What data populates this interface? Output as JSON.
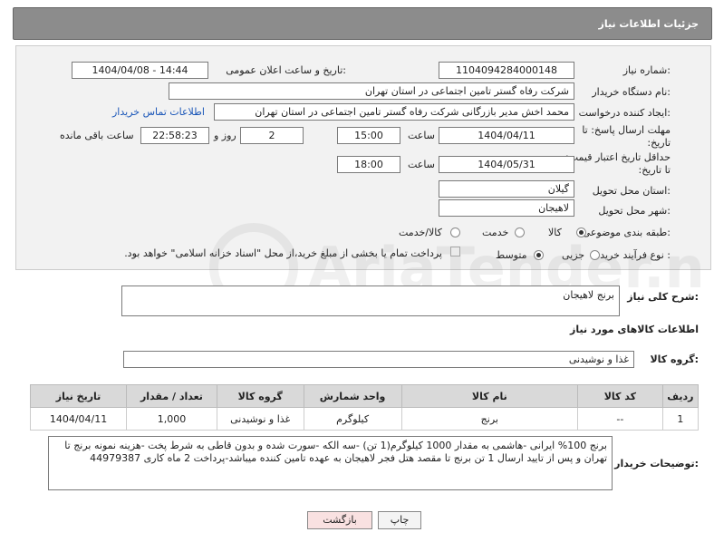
{
  "header": {
    "title": "جزئیات اطلاعات نیاز"
  },
  "fields": {
    "need_number_label": "شماره نیاز:",
    "need_number": "1104094284000148",
    "announce_label": "تاریخ و ساعت اعلان عمومی:",
    "announce_value": "1404/04/08 - 14:44",
    "buyer_org_label": "نام دستگاه خریدار:",
    "buyer_org": "شرکت رفاه گستر تامین اجتماعی در استان تهران",
    "creator_label": "ایجاد کننده درخواست:",
    "creator": "محمد اخش مدیر بازرگانی شرکت رفاه گستر تامین اجتماعی در استان تهران",
    "contact_link": "اطلاعات تماس خریدار",
    "reply_deadline_label": "مهلت ارسال پاسخ: تا تاریخ:",
    "reply_date": "1404/04/11",
    "time_word": "ساعت",
    "reply_time": "15:00",
    "days_value": "2",
    "days_word": "روز و",
    "remaining_time": "22:58:23",
    "remaining_word": "ساعت باقی مانده",
    "price_valid_label": "حداقل تاریخ اعتبار قیمت: تا تاریخ:",
    "price_date": "1404/05/31",
    "price_time": "18:00",
    "province_label": "استان محل تحویل:",
    "province": "گیلان",
    "city_label": "شهر محل تحویل:",
    "city": "لاهیجان",
    "category_label": "طبقه بندی موضوعی:",
    "category_options": [
      "کالا",
      "خدمت",
      "کالا/خدمت"
    ],
    "process_label": "نوع فرآیند خرید :",
    "process_options": [
      "جزیی",
      "متوسط"
    ],
    "payment_note": "پرداخت تمام یا بخشی از مبلغ خرید،از محل \"اسناد خزانه اسلامی\" خواهد بود."
  },
  "summary": {
    "label": "شرح کلی نیاز:",
    "value": "برنج لاهیجان"
  },
  "goods_info_title": "اطلاعات کالاهای مورد نیاز",
  "goods_group": {
    "label": "گروه کالا:",
    "value": "غذا و نوشیدنی"
  },
  "table": {
    "headers": [
      "ردیف",
      "کد کالا",
      "نام کالا",
      "واحد شمارش",
      "گروه کالا",
      "تعداد / مقدار",
      "تاریخ نیاز"
    ],
    "rows": [
      [
        "1",
        "--",
        "برنج",
        "کیلوگرم",
        "غذا و نوشیدنی",
        "1,000",
        "1404/04/11"
      ]
    ]
  },
  "buyer_notes": {
    "label": "توضیحات خریدار:",
    "value": "برنج 100% ایرانی -هاشمی به مقدار 1000 کیلوگرم(1 تن) -سه الکه -سورت شده و بدون قاطی به شرط پخت -هزینه نمونه برنج تا تهران و پس از تایید ارسال 1 تن برنج تا مقصد هتل فجر لاهیجان به عهده تامین کننده میباشد-پرداخت 2 ماه کاری 44979387"
  },
  "buttons": {
    "print": "چاپ",
    "back": "بازگشت"
  },
  "watermark": "AriaTender.net",
  "colors": {
    "header_bg": "#8c8c8c",
    "panel_bg": "#f2f2f2",
    "link": "#1a56b8",
    "back_button_bg": "#f9e1e1"
  }
}
